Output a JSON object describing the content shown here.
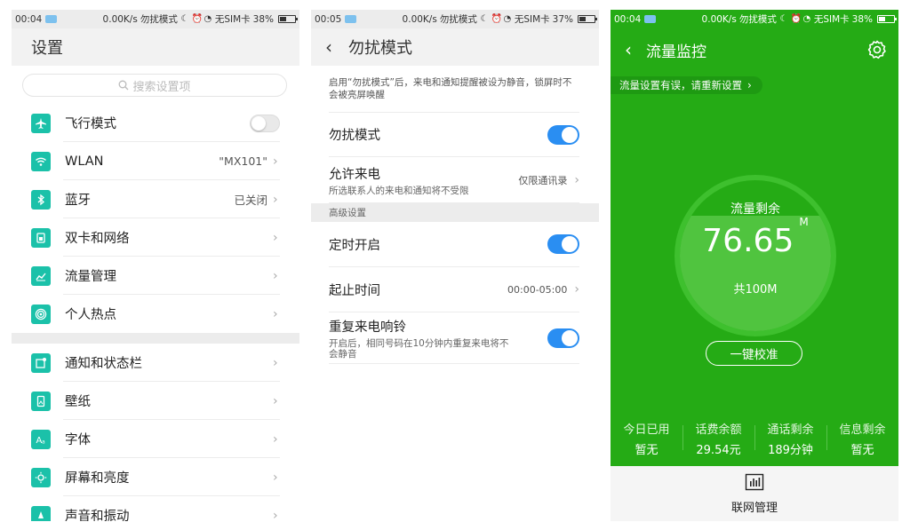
{
  "screen1": {
    "status": {
      "time": "00:04",
      "speed": "0.00K/s",
      "mode": "勿扰模式",
      "sim": "无SIM卡",
      "battery": "38%"
    },
    "title": "设置",
    "search_placeholder": "搜索设置项",
    "group1": [
      {
        "label": "飞行模式",
        "icon": "airplane-icon",
        "toggle": false
      },
      {
        "label": "WLAN",
        "icon": "wifi-icon",
        "value": "\"MX101\""
      },
      {
        "label": "蓝牙",
        "icon": "bluetooth-icon",
        "value": "已关闭"
      },
      {
        "label": "双卡和网络",
        "icon": "sim-card-icon"
      },
      {
        "label": "流量管理",
        "icon": "data-chart-icon"
      },
      {
        "label": "个人热点",
        "icon": "hotspot-icon"
      }
    ],
    "group2": [
      {
        "label": "通知和状态栏",
        "icon": "notification-icon"
      },
      {
        "label": "壁纸",
        "icon": "wallpaper-icon"
      },
      {
        "label": "字体",
        "icon": "font-icon"
      },
      {
        "label": "屏幕和亮度",
        "icon": "brightness-icon"
      },
      {
        "label": "声音和振动",
        "icon": "sound-icon"
      }
    ]
  },
  "screen2": {
    "status": {
      "time": "00:05",
      "speed": "0.00K/s",
      "mode": "勿扰模式",
      "sim": "无SIM卡",
      "battery": "37%"
    },
    "title": "勿扰模式",
    "description": "启用“勿扰模式”后，来电和通知提醒被设为静音，锁屏时不会被亮屏唤醒",
    "dnd_label": "勿扰模式",
    "allow_calls_label": "允许来电",
    "allow_calls_sub": "所选联系人的来电和通知将不受限",
    "allow_calls_value": "仅限通讯录",
    "advanced_section": "高级设置",
    "scheduled_label": "定时开启",
    "time_label": "起止时间",
    "time_value": "00:00-05:00",
    "repeat_label": "重复来电响铃",
    "repeat_sub": "开启后，相同号码在10分钟内重复来电将不会静音"
  },
  "screen3": {
    "status": {
      "time": "00:04",
      "speed": "0.00K/s",
      "mode": "勿扰模式",
      "sim": "无SIM卡",
      "battery": "38%"
    },
    "title": "流量监控",
    "notice": "流量设置有误，请重新设置",
    "remaining_label": "流量剩余",
    "remaining_value": "76.65",
    "remaining_unit": "M",
    "remaining_fraction": 0.7665,
    "total": "共100M",
    "calibrate": "一键校准",
    "stats": [
      {
        "label": "今日已用",
        "value": "暂无"
      },
      {
        "label": "话费余额",
        "value": "29.54元"
      },
      {
        "label": "通话剩余",
        "value": "189分钟"
      },
      {
        "label": "信息剩余",
        "value": "暂无"
      }
    ],
    "bottom_label": "联网管理"
  },
  "colors": {
    "accent_green": "#25ab15",
    "toggle_blue": "#2a8ef2",
    "icon_teal": "#1bc1a9"
  }
}
